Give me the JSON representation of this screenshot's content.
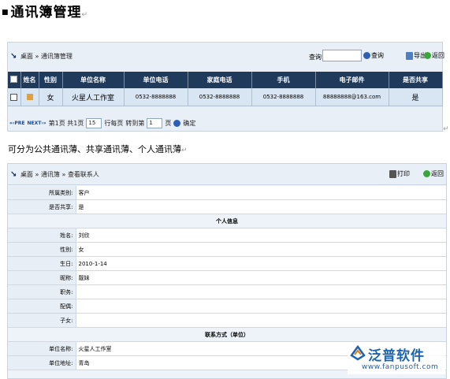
{
  "doc": {
    "title": "通讯簿管理",
    "para_mark": "↵",
    "paragraph": "可分为公共通讯薄、共享通讯薄、个人通讯薄"
  },
  "panel1": {
    "breadcrumb": [
      "桌面",
      "通讯簿管理"
    ],
    "crumb_sep": "»",
    "search_label": "查询:",
    "search_value": "",
    "query_button": "查询",
    "export_button": "导出",
    "back_button": "返回",
    "columns": [
      "",
      "姓名",
      "性别",
      "单位名称",
      "单位电话",
      "家庭电话",
      "手机",
      "电子邮件",
      "是否共享"
    ],
    "rows": [
      {
        "name": "",
        "gender": "女",
        "company": "火星人工作室",
        "work_phone": "0532-8888888",
        "home_phone": "0532-8888888",
        "mobile": "0532-8888888",
        "email": "88888888@163.com",
        "shared": "是"
      }
    ],
    "pager": {
      "nav_prev": "«‹PRE",
      "nav_next": "NEXT›»",
      "page_label_pre": "第1页 共1页",
      "per_page_value": "15",
      "per_page_label": "行每页",
      "goto_label": "转到第",
      "goto_value": "1",
      "goto_unit": "页",
      "confirm_label": "确定"
    }
  },
  "panel2": {
    "breadcrumb": [
      "桌面",
      "通讯簿",
      "查看联系人"
    ],
    "crumb_sep": "»",
    "print_button": "打印",
    "back_button": "返回",
    "rows": [
      {
        "label": "所属类别:",
        "value": "客户"
      },
      {
        "label": "是否共享:",
        "value": "是"
      },
      {
        "section": "个人信息"
      },
      {
        "label": "姓名:",
        "value": "刘欣"
      },
      {
        "label": "性别:",
        "value": "女"
      },
      {
        "label": "生日:",
        "value": "2010-1-14"
      },
      {
        "label": "昵称:",
        "value": "靓妹"
      },
      {
        "label": "职务:",
        "value": ""
      },
      {
        "label": "配偶:",
        "value": ""
      },
      {
        "label": "子女:",
        "value": ""
      },
      {
        "section": "联系方式（单位）"
      },
      {
        "label": "单位名称:",
        "value": "火星人工作室"
      },
      {
        "label": "单位地址:",
        "value": "青岛"
      }
    ]
  },
  "logo": {
    "name": "泛普软件",
    "url": "www.fanpusoft.com"
  },
  "colors": {
    "header_bg": "#1f3a5a",
    "row_bg": "#d8e6f3",
    "panel_bg": "#e9eff6",
    "logo_blue": "#1c64b0"
  }
}
